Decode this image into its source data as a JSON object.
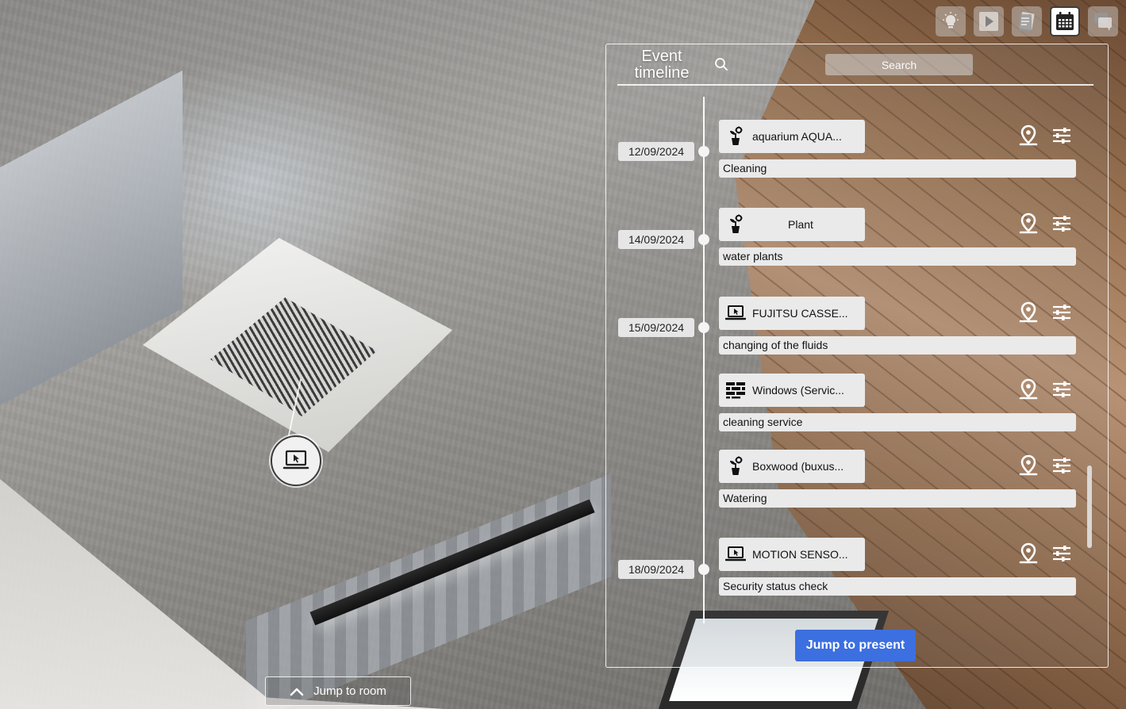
{
  "toolbar": {
    "buttons": [
      {
        "icon": "lightbulb-icon",
        "active": false
      },
      {
        "icon": "play-icon",
        "active": false
      },
      {
        "icon": "documents-icon",
        "active": false
      },
      {
        "icon": "calendar-icon",
        "active": true
      },
      {
        "icon": "chat-icon",
        "active": false
      }
    ]
  },
  "panel": {
    "title_line1": "Event",
    "title_line2": "timeline",
    "search_placeholder": "Search",
    "jump_to_present": "Jump to present"
  },
  "events": [
    {
      "date": "12/09/2024",
      "icon": "plant-icon",
      "name": "aquarium AQUA...",
      "description": "Cleaning"
    },
    {
      "date": "14/09/2024",
      "icon": "plant-icon",
      "name": "Plant",
      "description": "water plants"
    },
    {
      "date": "15/09/2024",
      "icon": "device-icon",
      "name": "FUJITSU CASSE...",
      "description": "changing of the fluids"
    },
    {
      "date": "",
      "icon": "brick-wall-icon",
      "name": "Windows (Servic...",
      "description": "cleaning service"
    },
    {
      "date": "",
      "icon": "plant-icon",
      "name": "Boxwood (buxus...",
      "description": "Watering"
    },
    {
      "date": "18/09/2024",
      "icon": "device-icon",
      "name": "MOTION SENSO...",
      "description": "Security status check"
    }
  ],
  "jump_room": {
    "label": "Jump to room"
  },
  "colors": {
    "accent": "#3c6fe0",
    "badge_bg": "#eaeaea",
    "panel_border": "#ffffff"
  }
}
